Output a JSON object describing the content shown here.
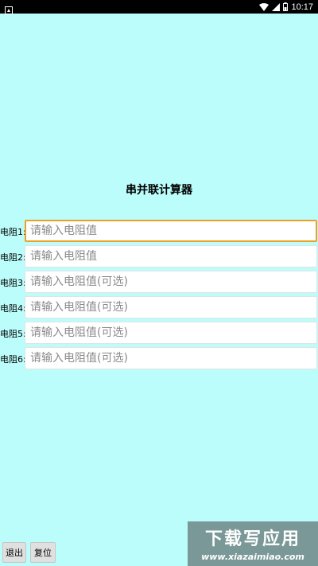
{
  "status_bar": {
    "time": "10:17"
  },
  "app": {
    "title": "串并联计算器"
  },
  "fields": [
    {
      "label": "电阻1:",
      "placeholder": "请输入电阻值"
    },
    {
      "label": "电阻2:",
      "placeholder": "请输入电阻值"
    },
    {
      "label": "电阻3:",
      "placeholder": "请输入电阻值(可选)"
    },
    {
      "label": "电阻4:",
      "placeholder": "请输入电阻值(可选)"
    },
    {
      "label": "电阻5:",
      "placeholder": "请输入电阻值(可选)"
    },
    {
      "label": "电阻6:",
      "placeholder": "请输入电阻值(可选)"
    }
  ],
  "buttons": {
    "exit": "退出",
    "reset": "复位"
  },
  "watermark": {
    "top": "下载写应用",
    "bottom": "www.xiazaimiao.com"
  },
  "colors": {
    "background": "#bbfdfb",
    "focus_border": "#f0a020"
  }
}
